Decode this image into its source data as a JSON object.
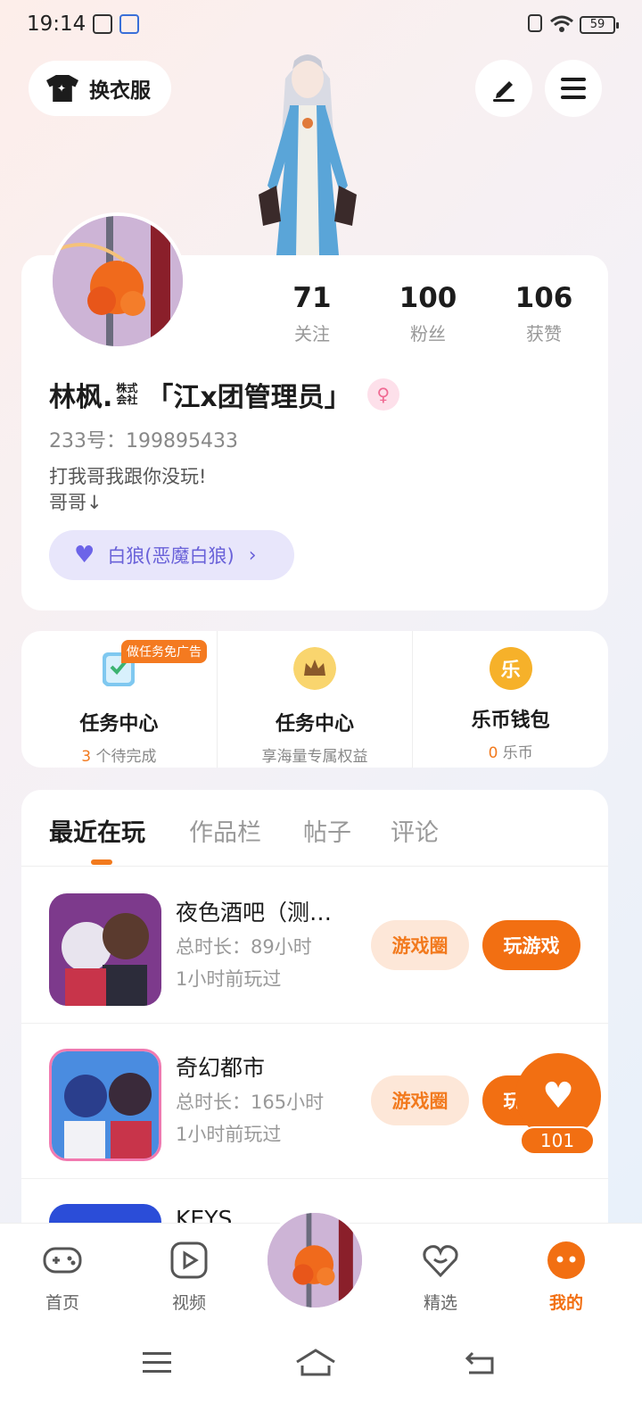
{
  "status_bar": {
    "time": "19:14",
    "battery": "59"
  },
  "top": {
    "dress_label": "换衣服"
  },
  "profile": {
    "stats": [
      {
        "num": "71",
        "label": "关注"
      },
      {
        "num": "100",
        "label": "粉丝"
      },
      {
        "num": "106",
        "label": "获赞"
      }
    ],
    "name": "林枫.",
    "corp": "株式会社",
    "title": "「江x团管理员」",
    "uid": "233号：199895433",
    "bio_line1": "打我哥我跟你没玩!",
    "bio_line2": "哥哥↓",
    "tag": "白狼(恶魔白狼)"
  },
  "quick": [
    {
      "title": "任务中心",
      "count": "3",
      "sub": " 个待完成",
      "badge": "做任务免广告"
    },
    {
      "title": "任务中心",
      "sub": "享海量专属权益"
    },
    {
      "title": "乐币钱包",
      "count": "0",
      "sub": " 乐币",
      "icon_text": "乐"
    }
  ],
  "tabs": [
    "最近在玩",
    "作品栏",
    "帖子",
    "评论"
  ],
  "games": [
    {
      "name": "夜色酒吧（测…",
      "duration": "总时长：89小时",
      "last": "1小时前玩过",
      "circle_label": "游戏圈",
      "play_label": "玩游戏"
    },
    {
      "name": "奇幻都市",
      "duration": "总时长：165小时",
      "last": "1小时前玩过",
      "circle_label": "游戏圈",
      "play_label": "玩游戏"
    },
    {
      "name": "KEYS…"
    }
  ],
  "float_like": {
    "count": "101"
  },
  "nav": [
    {
      "label": "首页"
    },
    {
      "label": "视频"
    },
    {
      "label": "精选"
    },
    {
      "label": "我的"
    }
  ]
}
